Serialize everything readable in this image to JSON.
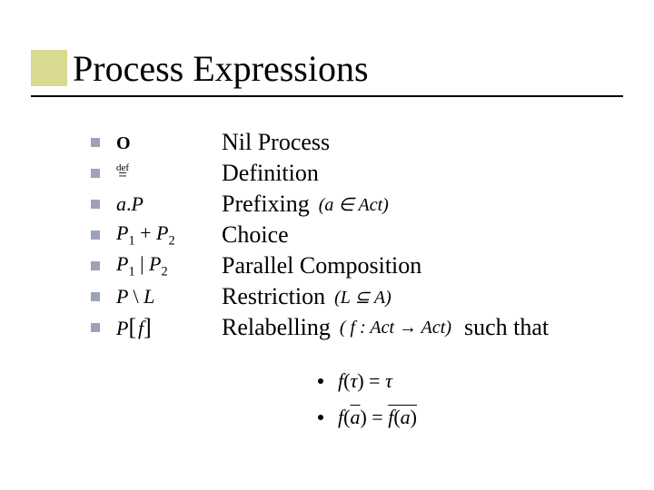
{
  "title": "Process Expressions",
  "items": [
    {
      "expr_html": "<span class='zero'>O</span>",
      "desc": "Nil Process",
      "ann": "",
      "suffix": ""
    },
    {
      "expr_html": "<span class='defsym'><span class='d'>def</span><span class='eq'>=</span></span>",
      "desc": "Definition",
      "ann": "",
      "suffix": ""
    },
    {
      "expr_html": "a<span class='upright'>.</span>P",
      "desc": "Prefixing",
      "ann": "(a ∈ Act)",
      "suffix": ""
    },
    {
      "expr_html": "P<span class='sub'>1</span> <span class='upright'>+</span> P<span class='sub'>2</span>",
      "desc": "Choice",
      "ann": "",
      "suffix": ""
    },
    {
      "expr_html": "P<span class='sub'>1</span> <span class='upright'>|</span> P<span class='sub'>2</span>",
      "desc": "Parallel Composition",
      "ann": "",
      "suffix": ""
    },
    {
      "expr_html": "P <span class='upright'>\\</span> L",
      "desc": "Restriction",
      "ann": "(L ⊆ A)",
      "suffix": ""
    },
    {
      "expr_html": "P<span class='big'>[</span>&#8202;f<span class='big'>]</span>",
      "desc": "Relabelling",
      "ann": "( f : Act → Act)",
      "suffix": "such that"
    }
  ],
  "conditions": [
    "f<span class='up'>(</span>τ<span class='up'>)</span> <span class='up'>=</span> τ",
    "f<span class='up'>(</span><span class='overline'>a</span><span class='up'>)</span> <span class='up'>=</span> <span class='overline'>f<span class='up'>(</span>a<span class='up'>)</span></span>"
  ]
}
